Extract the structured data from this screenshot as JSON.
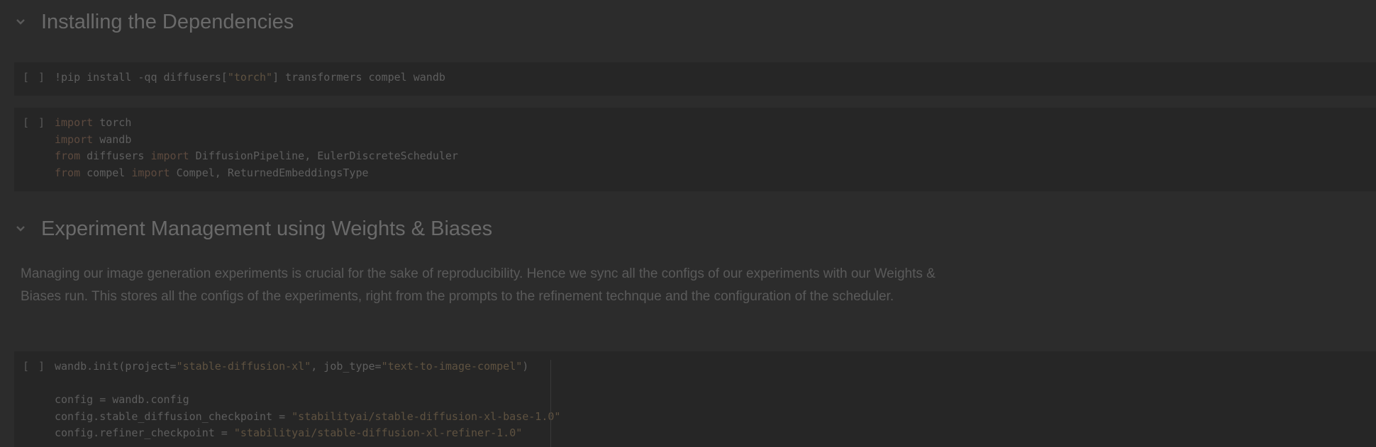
{
  "sections": [
    {
      "title": "Installing the Dependencies"
    },
    {
      "title": "Experiment Management using Weights & Biases"
    }
  ],
  "cells": {
    "run_label": "[ ]",
    "pip": {
      "line1": {
        "a": "!pip install -qq diffusers[",
        "b": "\"torch\"",
        "c": "] transformers compel wandb"
      }
    },
    "imports": {
      "line1": {
        "kw": "import",
        "rest": " torch"
      },
      "line2": {
        "kw": "import",
        "rest": " wandb"
      },
      "line3": {
        "kw1": "from",
        "mid": " diffusers ",
        "kw2": "import",
        "rest": " DiffusionPipeline, EulerDiscreteScheduler"
      },
      "line4": {
        "kw1": "from",
        "mid": " compel ",
        "kw2": "import",
        "rest": " Compel, ReturnedEmbeddingsType"
      }
    },
    "wandb": {
      "line1": {
        "a": "wandb.init(project=",
        "b": "\"stable-diffusion-xl\"",
        "c": ", job_type=",
        "d": "\"text-to-image-compel\"",
        "e": ")"
      },
      "line3": "config = wandb.config",
      "line4": {
        "a": "config.stable_diffusion_checkpoint = ",
        "b": "\"stabilityai/stable-diffusion-xl-base-1.0\""
      },
      "line5": {
        "a": "config.refiner_checkpoint = ",
        "b": "\"stabilityai/stable-diffusion-xl-refiner-1.0\""
      }
    }
  },
  "markdown": {
    "paragraph": "Managing our image generation experiments is crucial for the sake of reproducibility. Hence we sync all the configs of our experiments with our Weights & Biases run. This stores all the configs of the experiments, right from the prompts to the refinement technque and the configuration of the scheduler."
  }
}
